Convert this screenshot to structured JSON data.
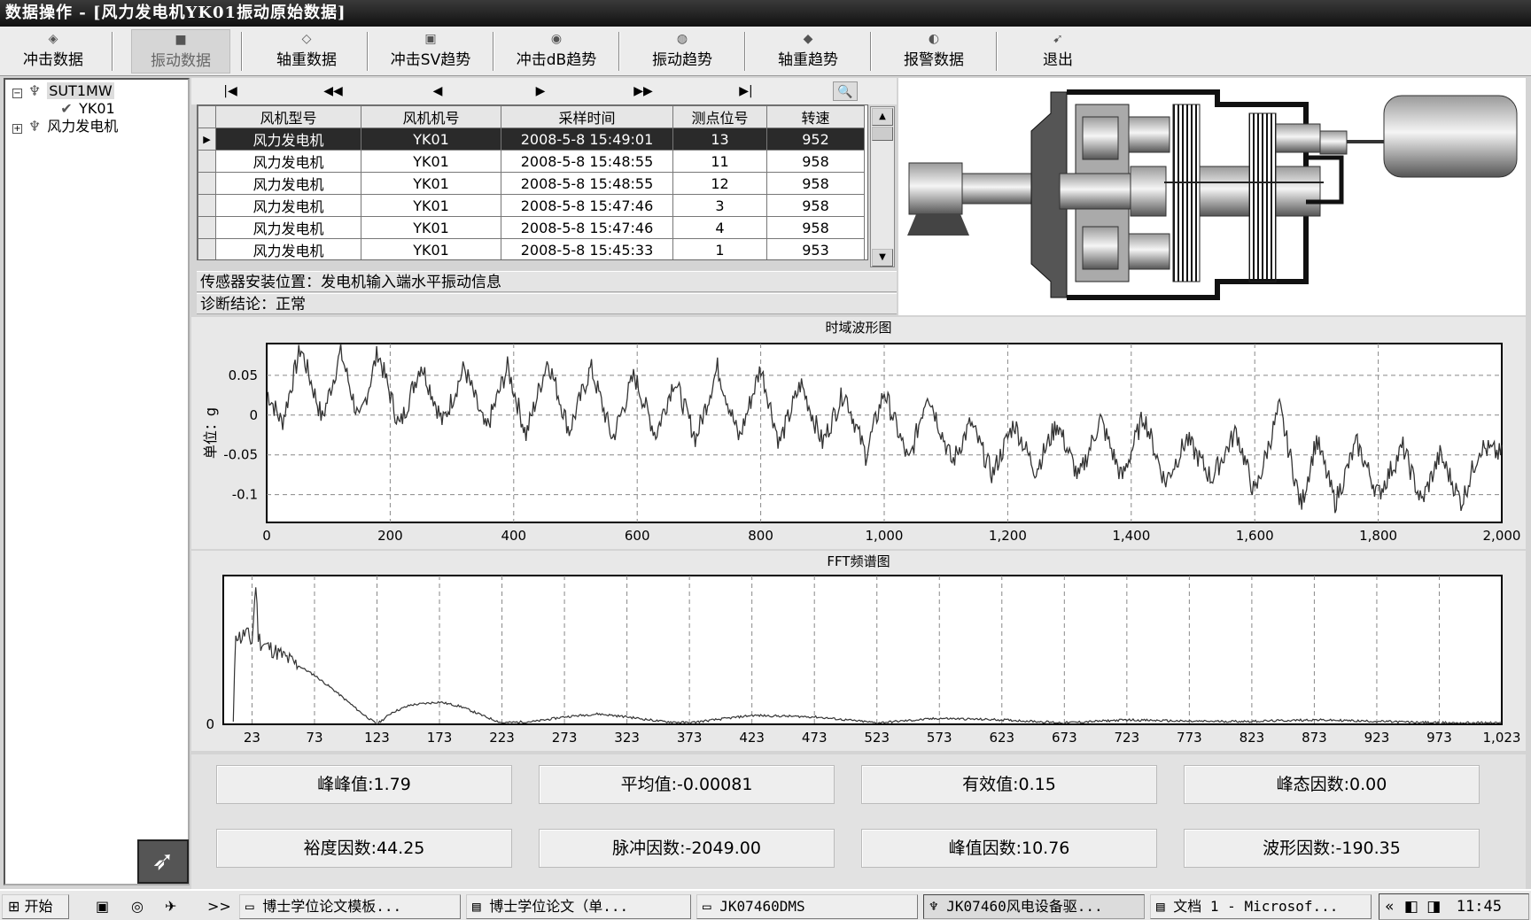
{
  "window": {
    "title": "数据操作 - [风力发电机YK01振动原始数据]"
  },
  "toolbar": [
    {
      "label": "冲击数据",
      "icon": "impact-data-icon",
      "active": false
    },
    {
      "label": "振动数据",
      "icon": "vibration-data-icon",
      "active": true
    },
    {
      "label": "轴重数据",
      "icon": "axle-load-data-icon",
      "active": false
    },
    {
      "label": "冲击SV趋势",
      "icon": "impact-sv-trend-icon",
      "active": false
    },
    {
      "label": "冲击dB趋势",
      "icon": "impact-db-trend-icon",
      "active": false
    },
    {
      "label": "振动趋势",
      "icon": "vibration-trend-icon",
      "active": false
    },
    {
      "label": "轴重趋势",
      "icon": "axle-load-trend-icon",
      "active": false
    },
    {
      "label": "报警数据",
      "icon": "alarm-data-icon",
      "active": false
    },
    {
      "label": "退出",
      "icon": "exit-icon",
      "active": false
    }
  ],
  "tree": {
    "root": "SUT1MW",
    "child": "YK01",
    "sibling": "风力发电机"
  },
  "nav": {
    "first": "|◀",
    "prev_page": "◀◀",
    "prev": "◀",
    "next": "▶",
    "next_page": "▶▶",
    "last": "▶|"
  },
  "grid": {
    "columns": [
      "风机型号",
      "风机机号",
      "采样时间",
      "测点位号",
      "转速"
    ],
    "rows": [
      [
        "风力发电机",
        "YK01",
        "2008-5-8 15:49:01",
        "13",
        "952"
      ],
      [
        "风力发电机",
        "YK01",
        "2008-5-8 15:48:55",
        "11",
        "958"
      ],
      [
        "风力发电机",
        "YK01",
        "2008-5-8 15:48:55",
        "12",
        "958"
      ],
      [
        "风力发电机",
        "YK01",
        "2008-5-8 15:47:46",
        "3",
        "958"
      ],
      [
        "风力发电机",
        "YK01",
        "2008-5-8 15:47:46",
        "4",
        "958"
      ],
      [
        "风力发电机",
        "YK01",
        "2008-5-8 15:45:33",
        "1",
        "953"
      ]
    ],
    "selected_index": 0
  },
  "info": {
    "sensor": "传感器安装位置：发电机输入端水平振动信息",
    "diagnosis": "诊断结论：正常"
  },
  "chart_data": [
    {
      "type": "line",
      "title": "时域波形图",
      "ylabel": "单位：g",
      "xlabel": "",
      "xlim": [
        0,
        2000
      ],
      "ylim": [
        -0.135,
        0.09
      ],
      "x_ticks": [
        "0",
        "200",
        "400",
        "600",
        "800",
        "1,000",
        "1,200",
        "1,400",
        "1,600",
        "1,800",
        "2,000"
      ],
      "y_ticks": [
        0.05,
        0,
        -0.05,
        -0.1
      ],
      "y_tick_labels": [
        "0.05",
        "0",
        "-0.05",
        "-0.1"
      ],
      "grid": true,
      "envelope": {
        "x": [
          0,
          25,
          55,
          90,
          120,
          150,
          180,
          215,
          250,
          285,
          320,
          355,
          390,
          420,
          455,
          490,
          525,
          560,
          595,
          630,
          660,
          695,
          730,
          765,
          800,
          830,
          865,
          900,
          935,
          970,
          1000,
          1040,
          1070,
          1110,
          1140,
          1175,
          1210,
          1245,
          1280,
          1315,
          1350,
          1385,
          1420,
          1455,
          1490,
          1530,
          1570,
          1600,
          1640,
          1675,
          1700,
          1730,
          1765,
          1800,
          1840,
          1870,
          1900,
          1935,
          1965,
          2000
        ],
        "y": [
          0.03,
          -0.01,
          0.085,
          -0.005,
          0.08,
          -0.01,
          0.08,
          -0.015,
          0.065,
          -0.01,
          0.06,
          -0.02,
          0.06,
          -0.025,
          0.07,
          -0.02,
          0.06,
          -0.03,
          0.05,
          -0.025,
          0.045,
          -0.03,
          0.06,
          -0.03,
          0.06,
          -0.035,
          0.04,
          -0.035,
          0.03,
          -0.05,
          0.03,
          -0.06,
          0.03,
          -0.06,
          -0.01,
          -0.075,
          -0.01,
          -0.07,
          -0.01,
          -0.08,
          -0.005,
          -0.08,
          0,
          -0.085,
          -0.03,
          -0.08,
          -0.02,
          -0.1,
          0.01,
          -0.115,
          -0.03,
          -0.11,
          -0.035,
          -0.1,
          -0.04,
          -0.11,
          -0.05,
          -0.11,
          -0.04,
          -0.05
        ]
      }
    },
    {
      "type": "line",
      "title": "FFT频谱图",
      "xlabel": "",
      "ylabel": "",
      "xlim": [
        0,
        1023
      ],
      "ylim": [
        0,
        1
      ],
      "x_ticks": [
        "23",
        "73",
        "123",
        "173",
        "223",
        "273",
        "323",
        "373",
        "423",
        "473",
        "523",
        "573",
        "623",
        "673",
        "723",
        "773",
        "823",
        "873",
        "923",
        "973",
        "1,023"
      ],
      "y_ticks": [
        0
      ],
      "y_tick_labels": [
        "0"
      ],
      "grid": true,
      "envelope": {
        "x": [
          8,
          10,
          14,
          18,
          23,
          26,
          28,
          30,
          40,
          55,
          73,
          90,
          110,
          123,
          135,
          150,
          173,
          190,
          210,
          223,
          250,
          273,
          300,
          323,
          350,
          373,
          423,
          473,
          523,
          573,
          623,
          673,
          723,
          773,
          823,
          873,
          923,
          973,
          1023
        ],
        "y": [
          0,
          0.62,
          0.58,
          0.62,
          0.55,
          0.95,
          0.6,
          0.55,
          0.5,
          0.42,
          0.33,
          0.22,
          0.08,
          0.0,
          0.08,
          0.13,
          0.15,
          0.12,
          0.05,
          0.01,
          0.02,
          0.05,
          0.07,
          0.05,
          0.02,
          0.01,
          0.06,
          0.05,
          0.01,
          0.04,
          0.03,
          0.01,
          0.03,
          0.02,
          0.02,
          0.03,
          0.02,
          0.01,
          0.01
        ]
      }
    }
  ],
  "stats": [
    "峰峰值:1.79",
    "平均值:-0.00081",
    "有效值:0.15",
    "峰态因数:0.00",
    "裕度因数:44.25",
    "脉冲因数:-2049.00",
    "峰值因数:10.76",
    "波形因数:-190.35"
  ],
  "taskbar": {
    "start": "开始",
    "quick": ">>",
    "tasks": [
      {
        "label": "博士学位论文模板...",
        "icon": "folder-icon"
      },
      {
        "label": "博士学位论文（单...",
        "icon": "word-doc-icon"
      },
      {
        "label": "JK07460DMS",
        "icon": "folder-icon"
      },
      {
        "label": "JK07460风电设备驱...",
        "icon": "app-icon"
      },
      {
        "label": "文档 1 - Microsof...",
        "icon": "word-doc-icon"
      }
    ],
    "tray_arrow": "«",
    "clock": "11:45"
  }
}
